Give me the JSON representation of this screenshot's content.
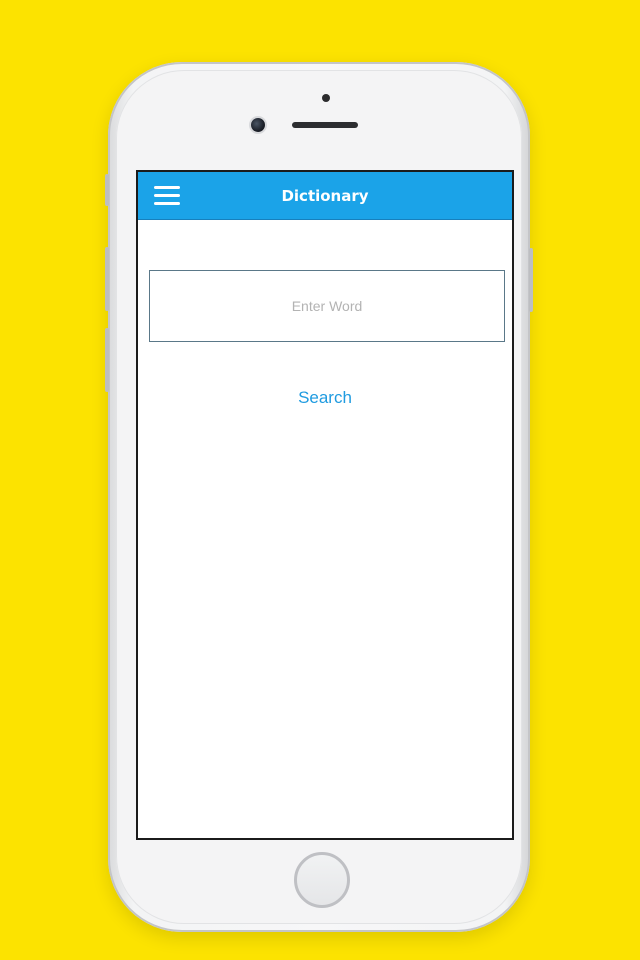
{
  "app": {
    "title": "Dictionary",
    "menu_icon": "hamburger-menu-icon"
  },
  "search": {
    "placeholder": "Enter Word",
    "value": "",
    "button_label": "Search"
  },
  "colors": {
    "background": "#FCE300",
    "app_bar": "#1BA3E8",
    "accent": "#1F9BE0",
    "placeholder": "#B3B3B3"
  }
}
